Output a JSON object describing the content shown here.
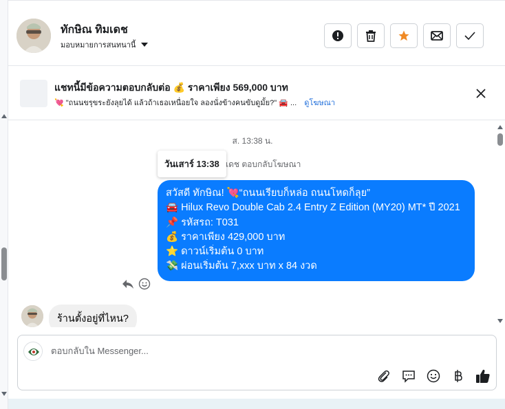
{
  "contact": {
    "name": "ทักษิณ ทิมเดช",
    "assigned_label": "มอบหมายการสนทนานี้"
  },
  "ad_banner": {
    "title": "แชทนี้มีข้อความตอบกลับต่อ 💰 ราคาเพียง 569,000 บาท",
    "snippet": "💘 \"ถนนขรุขระยังลุยได้ แล้วถ้าเธอเหนื่อยใจ ลองนั่งข้างคนขับดูมั้ย?\" 🚘 ...",
    "link": "ดูโฆษณา"
  },
  "conversation": {
    "timestamp": "ส. 13:38 น.",
    "tooltip": "วันเสาร์ 13:38",
    "replied_label": "เดช ตอบกลับโฆษณา",
    "outgoing_lines": [
      "สวัสดี ทักษิณ! 💘“ถนนเรียบก็หล่อ ถนนโหดก็ลุย”",
      "🚘 Hilux Revo Double Cab 2.4 Entry Z Edition (MY20) MT* ปี 2021",
      "📌 รหัสรถ: T031",
      "💰 ราคาเพียง 429,000 บาท",
      "⭐ ดาวน์เริ่มต้น 0 บาท",
      "💸 ผ่อนเริ่มต้น 7,xxx บาท x 84 งวด"
    ],
    "incoming": "ร้านตั้งอยู่ที่ไหน?"
  },
  "composer": {
    "placeholder": "ตอบกลับใน Messenger..."
  },
  "colors": {
    "bubble_out": "#0a7cff",
    "star": "#f08a24",
    "link": "#216fdb"
  },
  "icons": {
    "actions": [
      "alert-icon",
      "trash-icon",
      "star-icon",
      "envelope-icon",
      "check-icon"
    ],
    "tools": [
      "paperclip-icon",
      "chat-bubble-icon",
      "smiley-icon",
      "baht-icon",
      "thumbs-up-icon"
    ]
  }
}
